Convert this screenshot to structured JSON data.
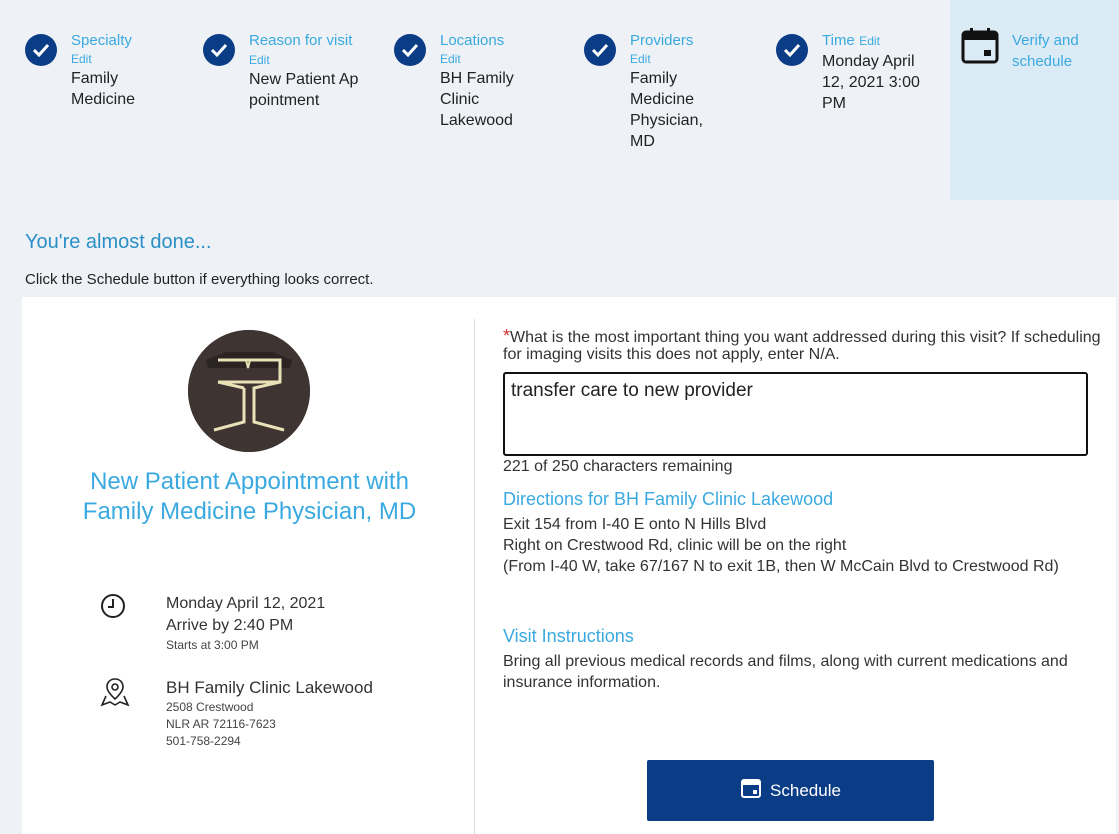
{
  "steps": [
    {
      "title": "Specialty",
      "edit": "Edit",
      "value": "Family Medicine"
    },
    {
      "title": "Reason for visit",
      "edit": "Edit",
      "value": "New Patient Appointment"
    },
    {
      "title": "Locations",
      "edit": "Edit",
      "value": "BH Family Clinic Lakewood"
    },
    {
      "title": "Providers",
      "edit": "Edit",
      "value": "Family Medicine Physician, MD"
    },
    {
      "title": "Time",
      "edit": "Edit",
      "value": "Monday April 12, 2021 3:00 PM"
    }
  ],
  "verify": {
    "label": "Verify and schedule"
  },
  "heading": "You're almost done...",
  "subheading": "Click the Schedule button if everything looks correct.",
  "appointment": {
    "title": "New Patient Appointment with Family Medicine Physician, MD",
    "date": "Monday April 12, 2021",
    "arrive": "Arrive by 2:40 PM",
    "starts": "Starts at 3:00 PM",
    "location_name": "BH Family Clinic Lakewood",
    "address1": "2508 Crestwood",
    "address2": "NLR AR 72116-7623",
    "phone": "501-758-2294"
  },
  "form": {
    "required_mark": "*",
    "question": "What is the most important thing you want addressed during this visit? If scheduling for imaging visits this does not apply, enter N/A.",
    "answer": "transfer care to new provider",
    "remaining": "221 of 250 characters remaining"
  },
  "directions": {
    "title": "Directions for BH Family Clinic Lakewood",
    "line1": "Exit 154 from I-40 E onto N Hills Blvd",
    "line2": "Right on Crestwood Rd, clinic will be on the right",
    "line3": "(From I-40 W, take 67/167 N to exit 1B, then W McCain Blvd to Crestwood Rd)"
  },
  "instructions": {
    "title": "Visit Instructions",
    "body": "Bring all previous medical records and films, along with current medications and insurance information."
  },
  "schedule_button": {
    "label": "Schedule"
  },
  "colors": {
    "primary": "#0b3d86",
    "accent": "#3aa9e0",
    "required": "#d0312d"
  }
}
